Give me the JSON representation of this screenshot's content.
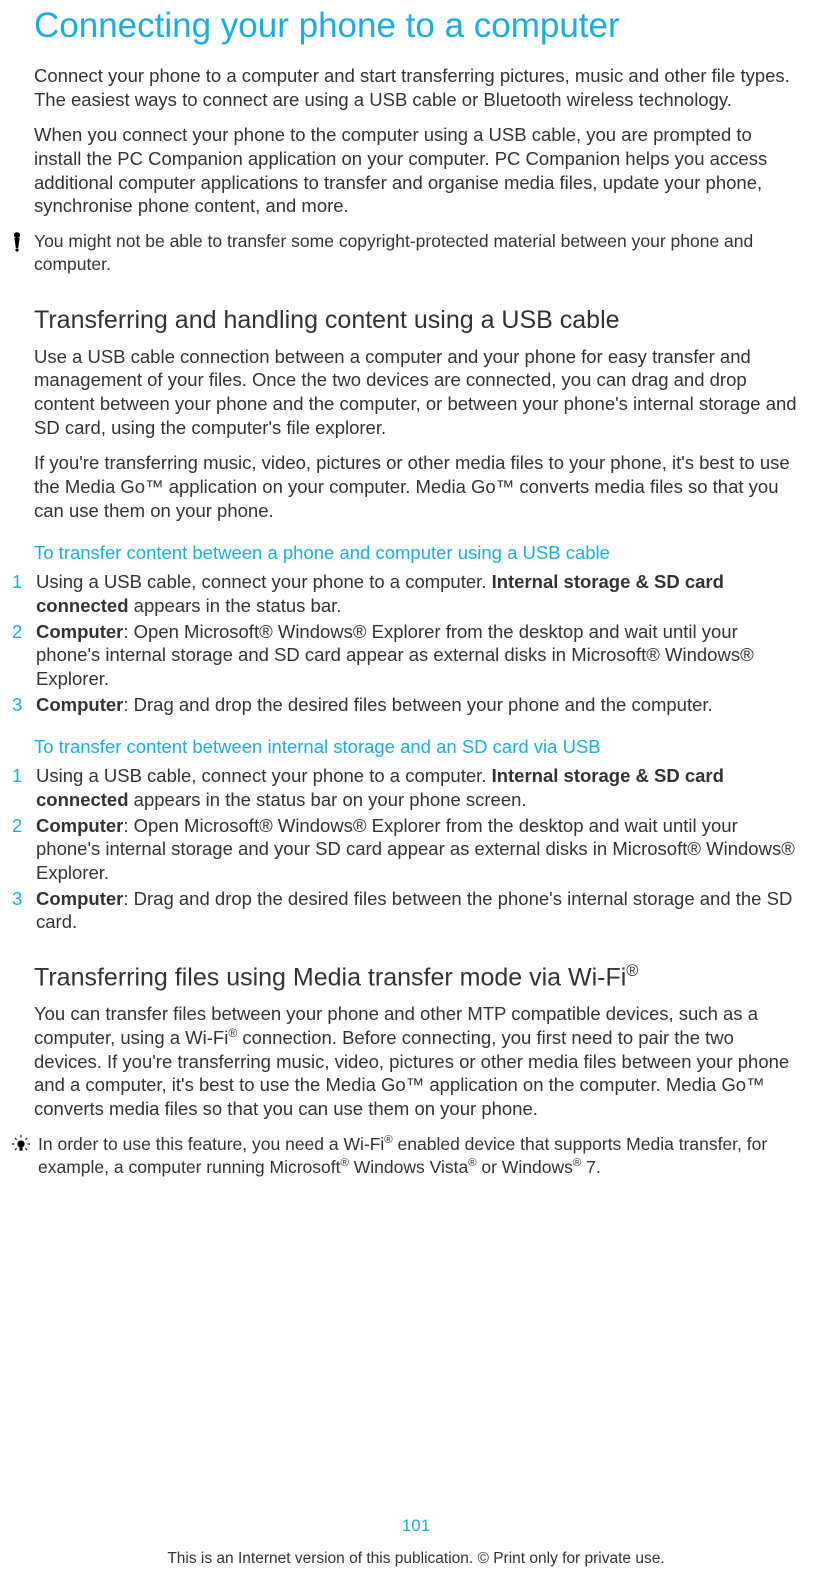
{
  "title": "Connecting your phone to a computer",
  "intro1": "Connect your phone to a computer and start transferring pictures, music and other file types. The easiest ways to connect are using a USB cable or Bluetooth wireless technology.",
  "intro2": "When you connect your phone to the computer using a USB cable, you are prompted to install the PC Companion application on your computer. PC Companion helps you access additional computer applications to transfer and organise media files, update your phone, synchronise phone content, and more.",
  "warn1": "You might not be able to transfer some copyright-protected material between your phone and computer.",
  "h2a": "Transferring and handling content using a USB cable",
  "p2a": "Use a USB cable connection between a computer and your phone for easy transfer and management of your files. Once the two devices are connected, you can drag and drop content between your phone and the computer, or between your phone's internal storage and SD card, using the computer's file explorer.",
  "p2b": "If you're transferring music, video, pictures or other media files to your phone, it's best to use the Media Go™ application on your computer. Media Go™ converts media files so that you can use them on your phone.",
  "task1_title": "To transfer content between a phone and computer using a USB cable",
  "task1": {
    "s1_pre": "Using a USB cable, connect your phone to a computer. ",
    "s1_bold": "Internal storage & SD card connected",
    "s1_post": " appears in the status bar.",
    "s2_bold": "Computer",
    "s2_post": ": Open Microsoft® Windows® Explorer from the desktop and wait until your phone's internal storage and SD card appear as external disks in Microsoft® Windows® Explorer.",
    "s3_bold": "Computer",
    "s3_post": ": Drag and drop the desired files between your phone and the computer."
  },
  "task2_title": "To transfer content between internal storage and an SD card via USB",
  "task2": {
    "s1_pre": "Using a USB cable, connect your phone to a computer. ",
    "s1_bold": "Internal storage & SD card connected",
    "s1_post": " appears in the status bar on your phone screen.",
    "s2_bold": "Computer",
    "s2_post": ": Open Microsoft® Windows® Explorer from the desktop and wait until your phone's internal storage and your SD card appear as external disks in Microsoft® Windows® Explorer.",
    "s3_bold": "Computer",
    "s3_post": ": Drag and drop the desired files between the phone's internal storage and the SD card."
  },
  "h2b_pre": "Transferring files using Media transfer mode via Wi-Fi",
  "h2b_sup": "®",
  "p3_pre": "You can transfer files between your phone and other MTP compatible devices, such as a computer, using a Wi-Fi",
  "p3_sup1": "®",
  "p3_post": " connection. Before connecting, you first need to pair the two devices. If you're transferring music, video, pictures or other media files between your phone and a computer, it's best to use the Media Go™ application on the computer. Media Go™ converts media files so that you can use them on your phone.",
  "tip_a": "In order to use this feature, you need a Wi-Fi",
  "tip_sup1": "®",
  "tip_b": " enabled device that supports Media transfer, for example, a computer running Microsoft",
  "tip_sup2": "®",
  "tip_c": " Windows Vista",
  "tip_sup3": "®",
  "tip_d": " or Windows",
  "tip_sup4": "®",
  "tip_e": " 7.",
  "nums": {
    "n1": "1",
    "n2": "2",
    "n3": "3"
  },
  "page_number": "101",
  "footer": "This is an Internet version of this publication. © Print only for private use."
}
